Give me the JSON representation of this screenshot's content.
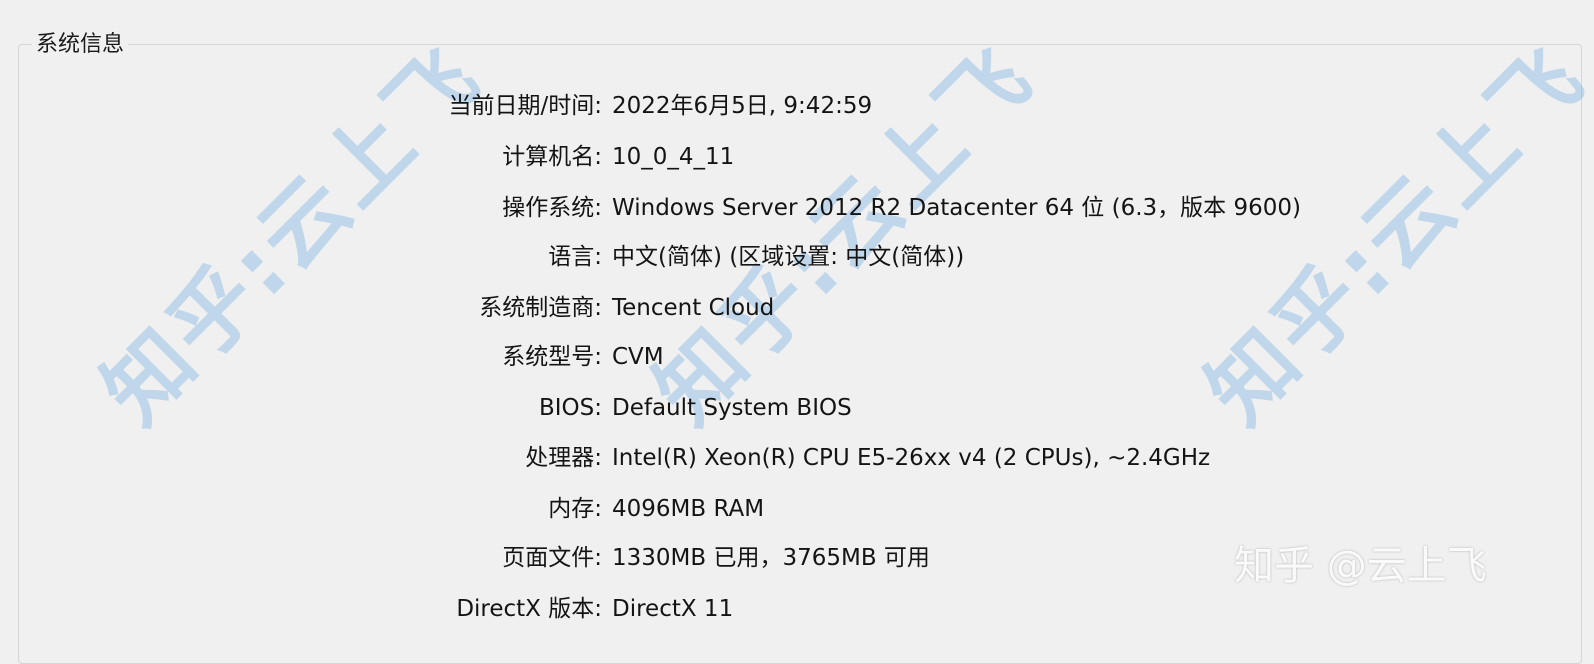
{
  "group": {
    "title": "系统信息"
  },
  "rows": [
    {
      "label": "当前日期/时间:",
      "value": "2022年6月5日, 9:42:59"
    },
    {
      "label": "计算机名:",
      "value": "10_0_4_11"
    },
    {
      "label": "操作系统:",
      "value": "Windows Server 2012 R2 Datacenter 64 位 (6.3，版本 9600)"
    },
    {
      "label": "语言:",
      "value": "中文(简体) (区域设置: 中文(简体))"
    },
    {
      "label": "系统制造商:",
      "value": "Tencent Cloud"
    },
    {
      "label": "系统型号:",
      "value": "CVM"
    },
    {
      "label": "BIOS:",
      "value": "Default System BIOS"
    },
    {
      "label": "处理器:",
      "value": "Intel(R) Xeon(R) CPU E5-26xx v4 (2 CPUs), ~2.4GHz"
    },
    {
      "label": "内存:",
      "value": "4096MB RAM"
    },
    {
      "label": "页面文件:",
      "value": "1330MB 已用，3765MB 可用"
    },
    {
      "label": "DirectX 版本:",
      "value": "DirectX 11"
    }
  ],
  "watermark": {
    "text": "知乎:云上飞",
    "brand": "知乎 @云上飞",
    "color": "#6eaae1"
  }
}
